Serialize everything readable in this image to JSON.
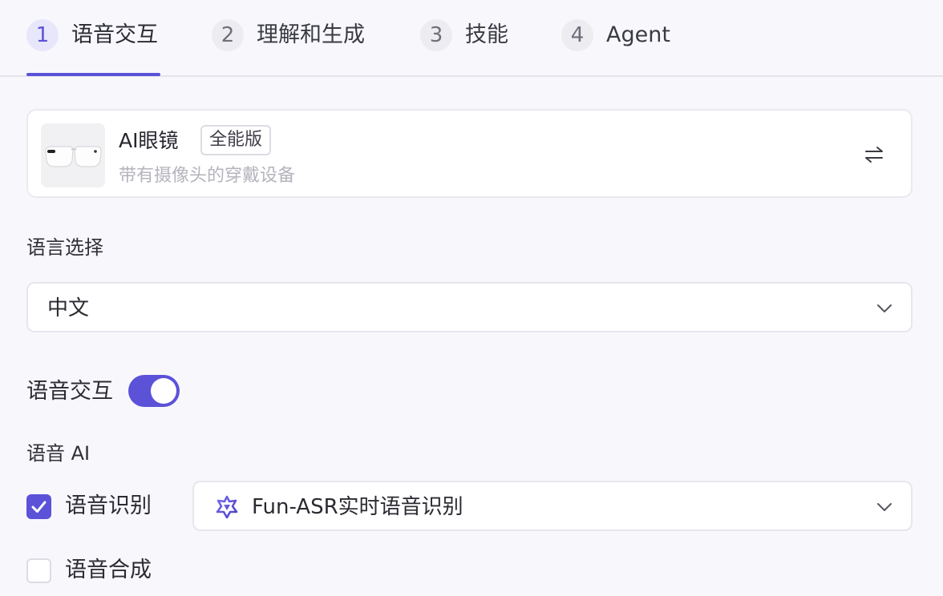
{
  "tabs": [
    {
      "num": "1",
      "label": "语音交互",
      "active": true
    },
    {
      "num": "2",
      "label": "理解和生成",
      "active": false
    },
    {
      "num": "3",
      "label": "技能",
      "active": false
    },
    {
      "num": "4",
      "label": "Agent",
      "active": false
    }
  ],
  "device": {
    "name": "AI眼镜",
    "badge": "全能版",
    "description": "带有摄像头的穿戴设备",
    "switch_icon": "swap-arrows-icon"
  },
  "language": {
    "label": "语言选择",
    "selected": "中文"
  },
  "voice_interaction": {
    "label": "语音交互",
    "enabled": true
  },
  "voice_ai": {
    "label": "语音 AI",
    "asr": {
      "label": "语音识别",
      "checked": true,
      "model": "Fun-ASR实时语音识别"
    },
    "tts": {
      "label": "语音合成",
      "checked": false
    }
  },
  "colors": {
    "accent": "#5b52d8",
    "background": "#f8f8fc",
    "muted_text": "#b4b4bd"
  }
}
